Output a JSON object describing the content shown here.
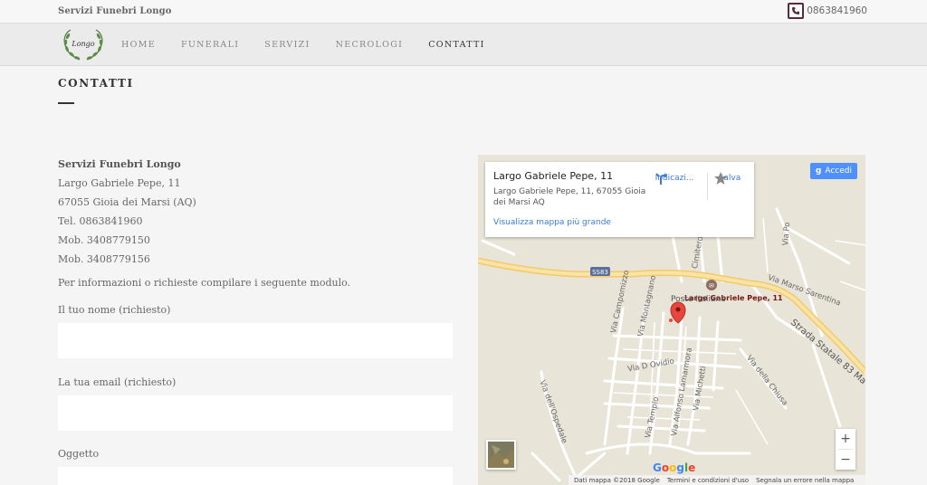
{
  "topbar": {
    "brand": "Servizi Funebri Longo",
    "phone": "0863841960",
    "phone_icon": "phone-icon"
  },
  "nav": {
    "logo_text": "Longo",
    "items": [
      {
        "label": "HOME",
        "active": false
      },
      {
        "label": "FUNERALI",
        "active": false
      },
      {
        "label": "SERVIZI",
        "active": false
      },
      {
        "label": "NECROLOGI",
        "active": false
      },
      {
        "label": "CONTATTI",
        "active": true
      }
    ]
  },
  "page": {
    "title": "CONTATTI"
  },
  "contact": {
    "name": "Servizi Funebri Longo",
    "address": "Largo Gabriele Pepe, 11",
    "city": "67055 Gioia dei Marsi (AQ)",
    "tel": "Tel. 0863841960",
    "mob1": "Mob. 3408779150",
    "mob2": "Mob. 3408779156",
    "intro": "Per informazioni o richieste compilare i seguente modulo."
  },
  "form": {
    "name_label": "Il tuo nome (richiesto)",
    "email_label": "La tua email (richiesto)",
    "subject_label": "Oggetto"
  },
  "map": {
    "card_title": "Largo Gabriele Pepe, 11",
    "card_address": "Largo Gabriele Pepe, 11, 67055 Gioia dei Marsi AQ",
    "directions_label": "Indicazi...",
    "save_label": "Salva",
    "larger_map_link": "Visualizza mappa più grande",
    "signin_label": "Accedi",
    "zoom_in": "+",
    "zoom_out": "−",
    "google_logo": "Google",
    "footer": {
      "data": "Dati mappa ©2018 Google",
      "terms": "Termini e condizioni d'uso",
      "report": "Segnala un errore nella mappa"
    },
    "pin_label": "Largo Gabriele Pepe, 11",
    "road_badge": "SS83",
    "street_labels": {
      "poste": "Poste Italiane",
      "campomizzo": "Via Campomizzo",
      "montagnano": "Via Montagnano",
      "dovidio": "Via D Ovidio",
      "tempio": "Via Tempio",
      "lamarmora": "Via Alfonso Lamarmora",
      "michetti": "Via Michetti",
      "ospedale": "Via dell'Ospedale",
      "chiusa": "Via della Chiusa",
      "statale": "Strada Statale 83 Ma",
      "sarentina": "Via Marso Sarentina",
      "cimitero": "Cimitero",
      "po": "Via Po"
    },
    "colors": {
      "pin": "#e8453c",
      "road_major": "#f6d98a",
      "link": "#3a7bd5"
    }
  }
}
